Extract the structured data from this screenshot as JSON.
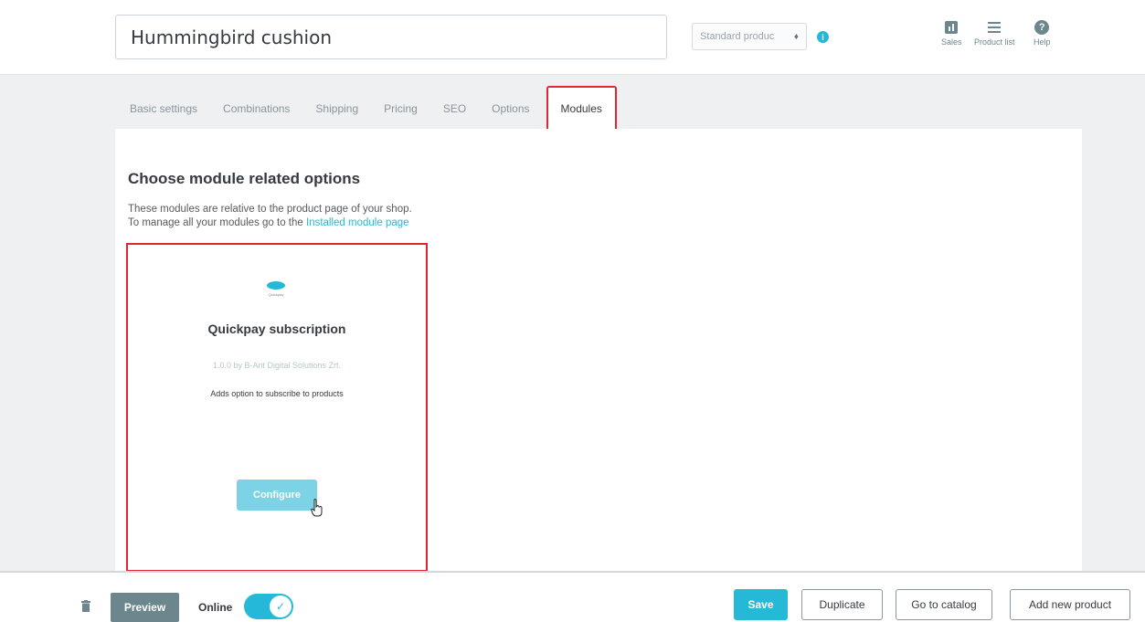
{
  "header": {
    "product_name": "Hummingbird cushion",
    "product_type": "Standard produc",
    "links": [
      {
        "label": "Sales"
      },
      {
        "label": "Product list"
      },
      {
        "label": "Help"
      }
    ]
  },
  "tabs": [
    {
      "label": "Basic settings"
    },
    {
      "label": "Combinations"
    },
    {
      "label": "Shipping"
    },
    {
      "label": "Pricing"
    },
    {
      "label": "SEO"
    },
    {
      "label": "Options"
    },
    {
      "label": "Modules",
      "active": true
    }
  ],
  "main": {
    "title": "Choose module related options",
    "desc_line1": "These modules are relative to the product page of your shop.",
    "desc_line2": "To manage all your modules go to the",
    "link_text": "Installed module page"
  },
  "module": {
    "logo_text": "Quickpay",
    "name": "Quickpay subscription",
    "version": "1.0.0 by B-Ant Digital Solutions Zrt.",
    "description": "Adds option to subscribe to products",
    "configure_label": "Configure"
  },
  "footer": {
    "preview_label": "Preview",
    "online_label": "Online",
    "online_enabled": true,
    "save_label": "Save",
    "duplicate_label": "Duplicate",
    "catalog_label": "Go to catalog",
    "add_new_label": "Add new product"
  },
  "colors": {
    "accent": "#25b9d7",
    "highlight": "#e0262e",
    "secondary": "#6c868e"
  },
  "icons": [
    "info-icon",
    "sales-icon",
    "product-list-icon",
    "help-icon",
    "module-logo-icon",
    "hand-cursor-icon",
    "trash-icon",
    "check-icon"
  ]
}
